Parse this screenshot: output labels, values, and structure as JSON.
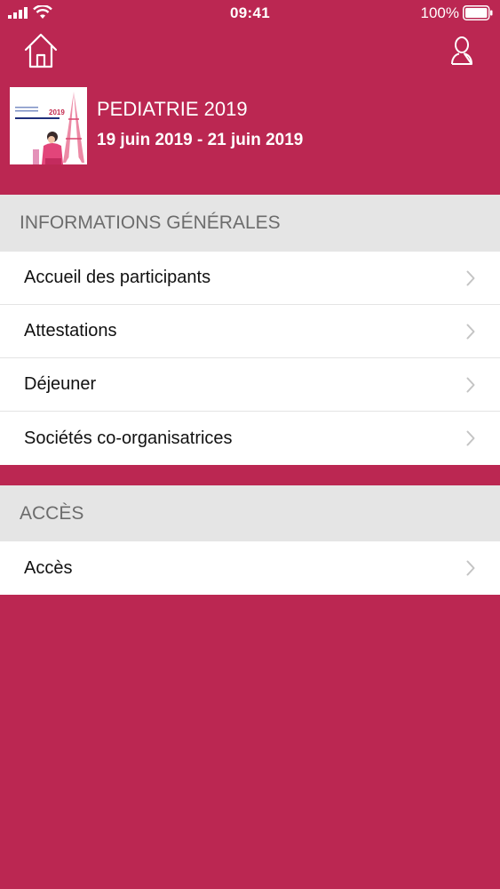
{
  "status_bar": {
    "time": "09:41",
    "battery_percent": "100%",
    "signal_icon": "cellular-signal-icon",
    "wifi_icon": "wifi-icon",
    "battery_icon": "battery-icon"
  },
  "nav": {
    "home_icon": "home-icon",
    "profile_icon": "profile-icon"
  },
  "event": {
    "title": "PEDIATRIE 2019",
    "dates": "19 juin 2019 - 21 juin 2019",
    "thumbnail": {
      "year": "2019",
      "venue": "PALAIS DES CONGRÈS DE PARIS"
    }
  },
  "sections": [
    {
      "header": "INFORMATIONS GÉNÉRALES",
      "items": [
        {
          "label": "Accueil des participants"
        },
        {
          "label": "Attestations"
        },
        {
          "label": "Déjeuner"
        },
        {
          "label": "Sociétés co-organisatrices"
        }
      ]
    },
    {
      "header": "ACCÈS",
      "items": [
        {
          "label": "Accès"
        }
      ]
    }
  ],
  "colors": {
    "brand": "#bb2752",
    "section_header_bg": "#e5e5e5",
    "section_header_text": "#6c6c6c",
    "list_bg": "#ffffff",
    "chevron": "#c4c4c4"
  }
}
